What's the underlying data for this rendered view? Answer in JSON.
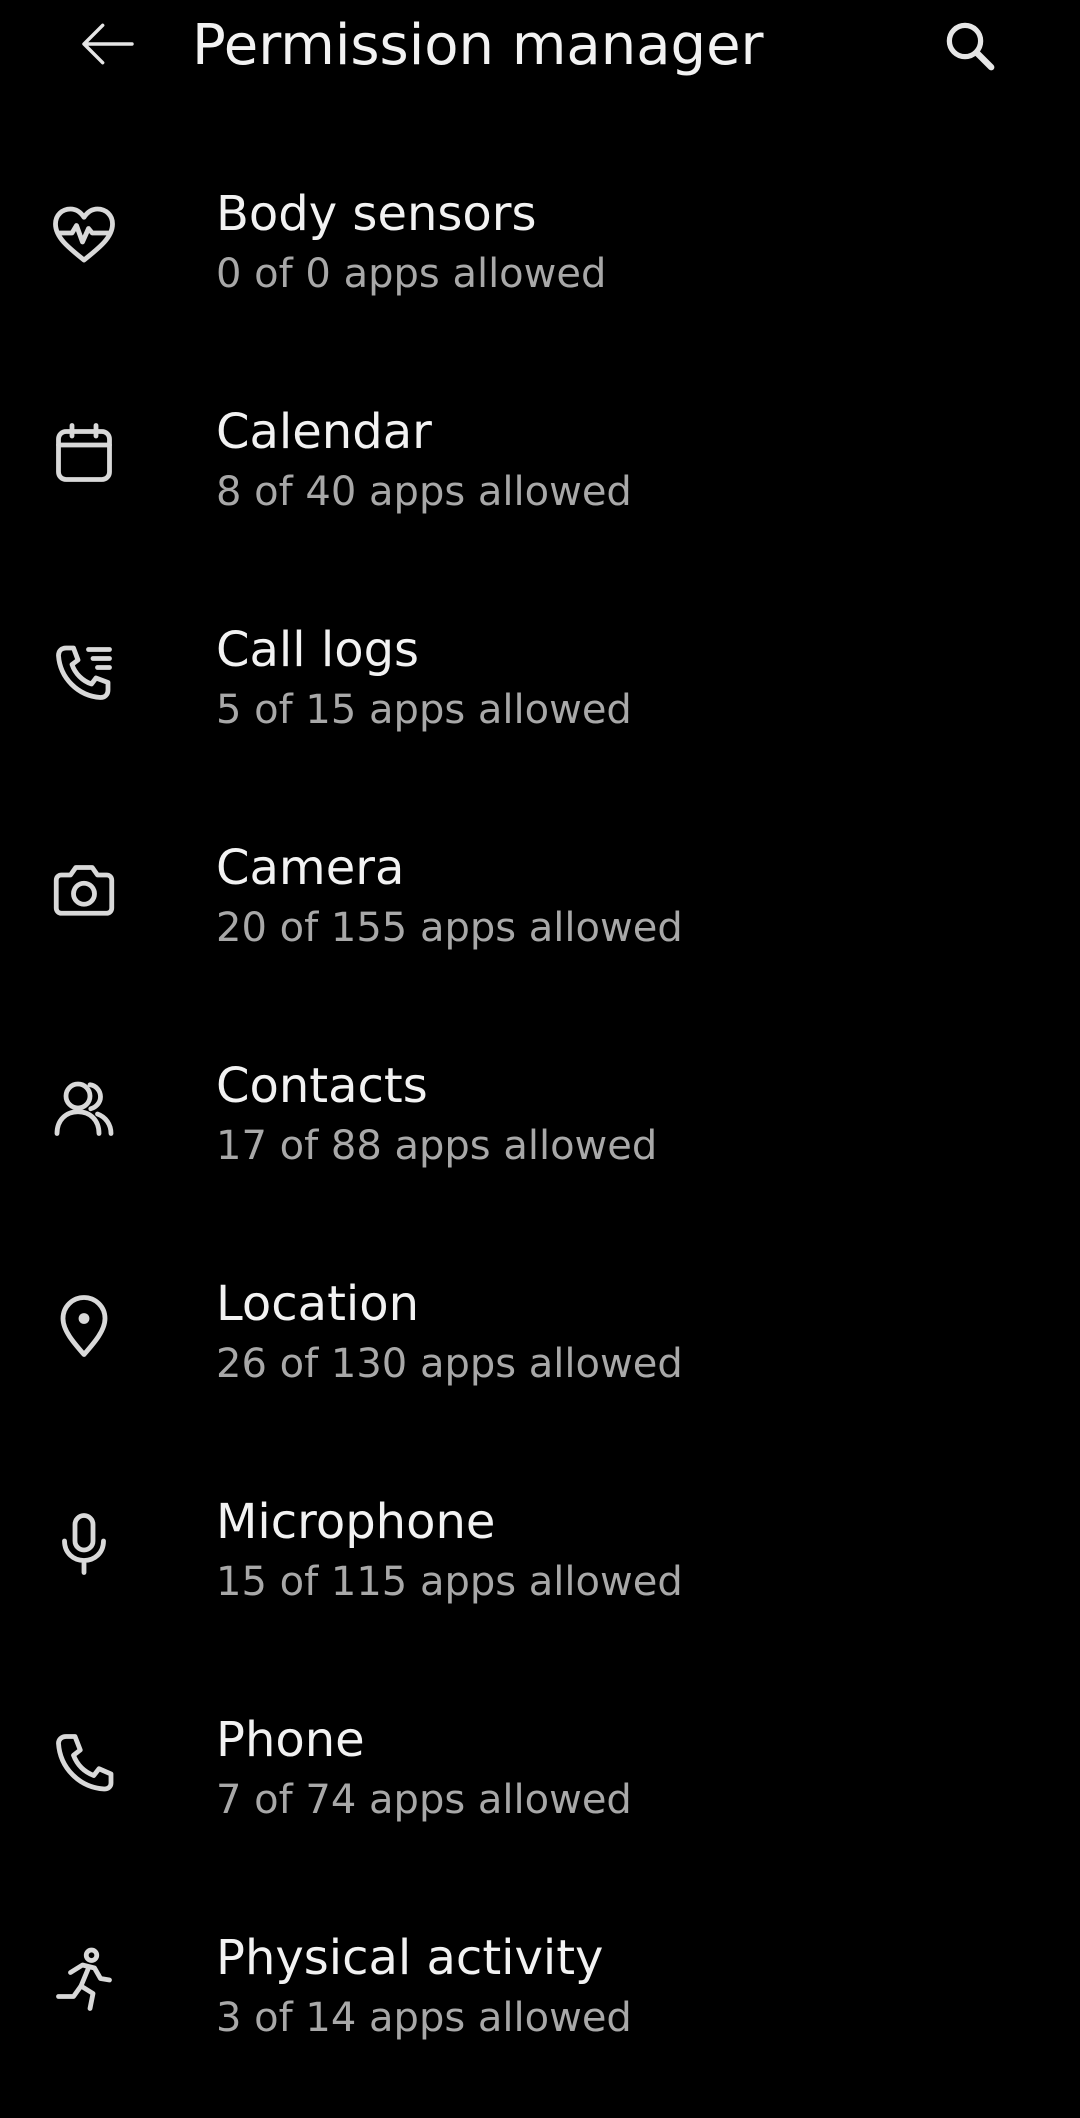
{
  "header": {
    "title": "Permission manager",
    "back_icon": "arrow-back-icon",
    "search_icon": "search-icon"
  },
  "colors": {
    "background": "#000000",
    "primary_text": "#f2f2f2",
    "secondary_text": "#a8a8a8",
    "icon": "#d9d9d9"
  },
  "permissions": [
    {
      "name": "Body sensors",
      "summary": "0 of 0 apps allowed",
      "icon": "heart-pulse-icon"
    },
    {
      "name": "Calendar",
      "summary": "8 of 40 apps allowed",
      "icon": "calendar-icon"
    },
    {
      "name": "Call logs",
      "summary": "5 of 15 apps allowed",
      "icon": "call-log-icon"
    },
    {
      "name": "Camera",
      "summary": "20 of 155 apps allowed",
      "icon": "camera-icon"
    },
    {
      "name": "Contacts",
      "summary": "17 of 88 apps allowed",
      "icon": "contacts-icon"
    },
    {
      "name": "Location",
      "summary": "26 of 130 apps allowed",
      "icon": "location-pin-icon"
    },
    {
      "name": "Microphone",
      "summary": "15 of 115 apps allowed",
      "icon": "microphone-icon"
    },
    {
      "name": "Phone",
      "summary": "7 of 74 apps allowed",
      "icon": "phone-icon"
    },
    {
      "name": "Physical activity",
      "summary": "3 of 14 apps allowed",
      "icon": "running-person-icon"
    }
  ]
}
